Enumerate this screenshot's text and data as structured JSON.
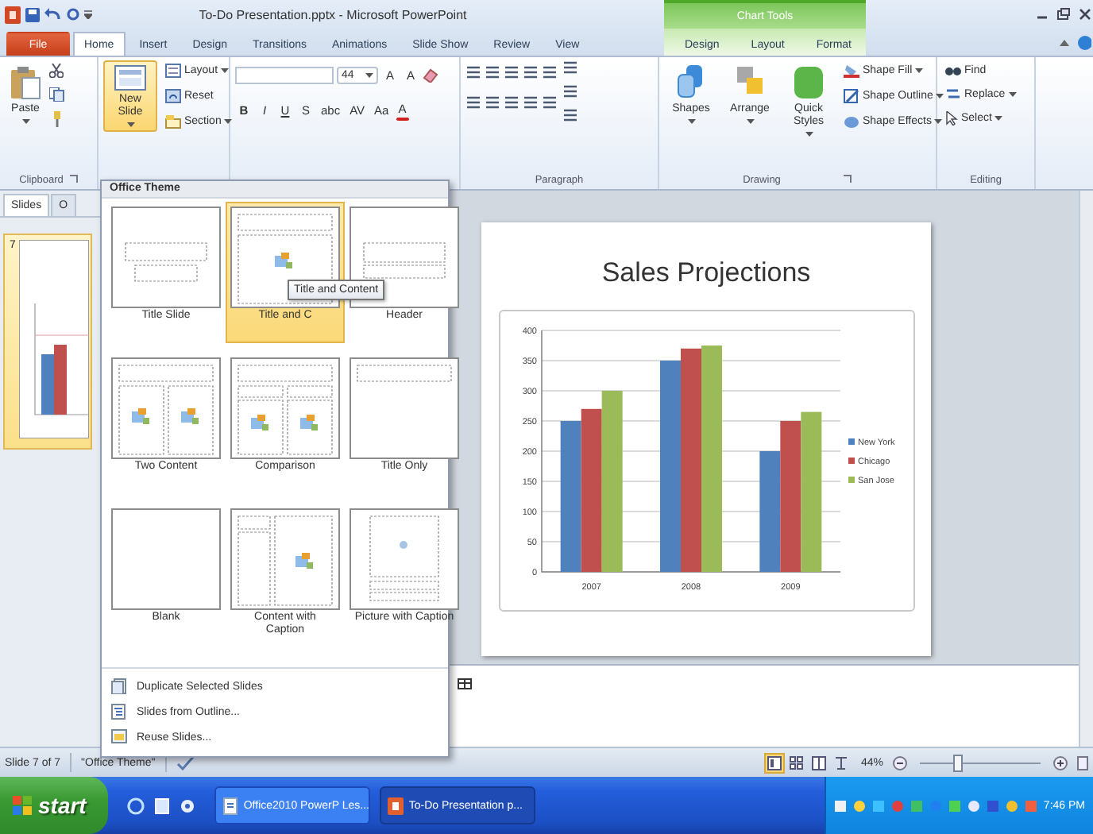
{
  "title_bar": {
    "title": "To-Do Presentation.pptx - Microsoft PowerPoint",
    "context_header": "Chart Tools"
  },
  "file_tab": "File",
  "tabs": [
    {
      "label": "Home",
      "selected": true
    },
    {
      "label": "Insert",
      "selected": false
    },
    {
      "label": "Design",
      "selected": false
    },
    {
      "label": "Transitions",
      "selected": false
    },
    {
      "label": "Animations",
      "selected": false
    },
    {
      "label": "Slide Show",
      "selected": false
    },
    {
      "label": "Review",
      "selected": false
    },
    {
      "label": "View",
      "selected": false
    }
  ],
  "context_tabs": [
    {
      "label": "Design",
      "selected": false
    },
    {
      "label": "Layout",
      "selected": false
    },
    {
      "label": "Format",
      "selected": false
    }
  ],
  "ribbon": {
    "clipboard": {
      "paste": "Paste",
      "label": "Clipboard"
    },
    "slides": {
      "new_slide": {
        "label": "New Slide",
        "selected": true
      },
      "layout": "Layout",
      "reset": "Reset",
      "section": "Section"
    },
    "font": {
      "size": "44",
      "size_buttons": [
        "A",
        "A"
      ],
      "format_buttons": [
        "B",
        "I",
        "U",
        "S",
        "abc",
        "AV",
        "Aa",
        "A"
      ]
    },
    "paragraph": {
      "label": "Paragraph"
    },
    "drawing": {
      "shapes": "Shapes",
      "arrange": "Arrange",
      "quick_styles": "Quick Styles",
      "shape_fill": "Shape Fill",
      "shape_outline": "Shape Outline",
      "shape_effects": "Shape Effects",
      "label": "Drawing"
    },
    "editing": {
      "find": "Find",
      "replace": "Replace",
      "select": "Select",
      "label": "Editing"
    }
  },
  "slides_pane": {
    "tabs": [
      {
        "label": "Slides",
        "selected": true
      },
      {
        "label": "O",
        "selected": false
      }
    ],
    "thumbnails": [
      {
        "number": "7",
        "selected": true
      }
    ]
  },
  "layout_menu": {
    "header": "Office Theme",
    "tooltip": "Title and Content",
    "layouts": [
      {
        "label": "Title Slide",
        "kind": "title",
        "selected": false
      },
      {
        "label": "Title and C",
        "kind": "title_content",
        "selected": true
      },
      {
        "label": "Header",
        "kind": "section",
        "selected": false
      },
      {
        "label": "Two Content",
        "kind": "two",
        "selected": false
      },
      {
        "label": "Comparison",
        "kind": "comparison",
        "selected": false
      },
      {
        "label": "Title Only",
        "kind": "title_only",
        "selected": false
      },
      {
        "label": "Blank",
        "kind": "blank",
        "selected": false
      },
      {
        "label": "Content with Caption",
        "kind": "content_caption",
        "selected": false
      },
      {
        "label": "Picture with Caption",
        "kind": "picture_caption",
        "selected": false
      }
    ],
    "commands": [
      "Duplicate Selected Slides",
      "Slides from Outline...",
      "Reuse Slides..."
    ]
  },
  "slide": {
    "title": "Sales Projections",
    "chart_data": {
      "type": "bar",
      "grid": true,
      "legend": true,
      "categories": [
        "2007",
        "2008",
        "2009"
      ],
      "ylim": [
        0,
        400
      ],
      "yticks": [
        0,
        50,
        100,
        150,
        200,
        250,
        300,
        350,
        400
      ],
      "series": [
        {
          "name": "New York",
          "color": "#4f81bd",
          "values": [
            250,
            350,
            200
          ]
        },
        {
          "name": "Chicago",
          "color": "#c0504d",
          "values": [
            270,
            370,
            250
          ]
        },
        {
          "name": "San Jose",
          "color": "#9bbb59",
          "values": [
            300,
            375,
            265
          ]
        }
      ]
    }
  },
  "status_bar": {
    "slide": "Slide 7 of 7",
    "theme": "\"Office Theme\"",
    "views": [
      {
        "selected": true
      },
      {
        "selected": false
      },
      {
        "selected": false
      },
      {
        "selected": false
      }
    ],
    "zoom": "44%",
    "zoom_slider": {
      "level": 0.3
    }
  },
  "taskbar": {
    "start": "start",
    "tasks": [
      {
        "label": "Office2010 PowerP Les...",
        "selected": false
      },
      {
        "label": "To-Do Presentation p...",
        "selected": true
      }
    ],
    "clock": "7:46 PM"
  }
}
